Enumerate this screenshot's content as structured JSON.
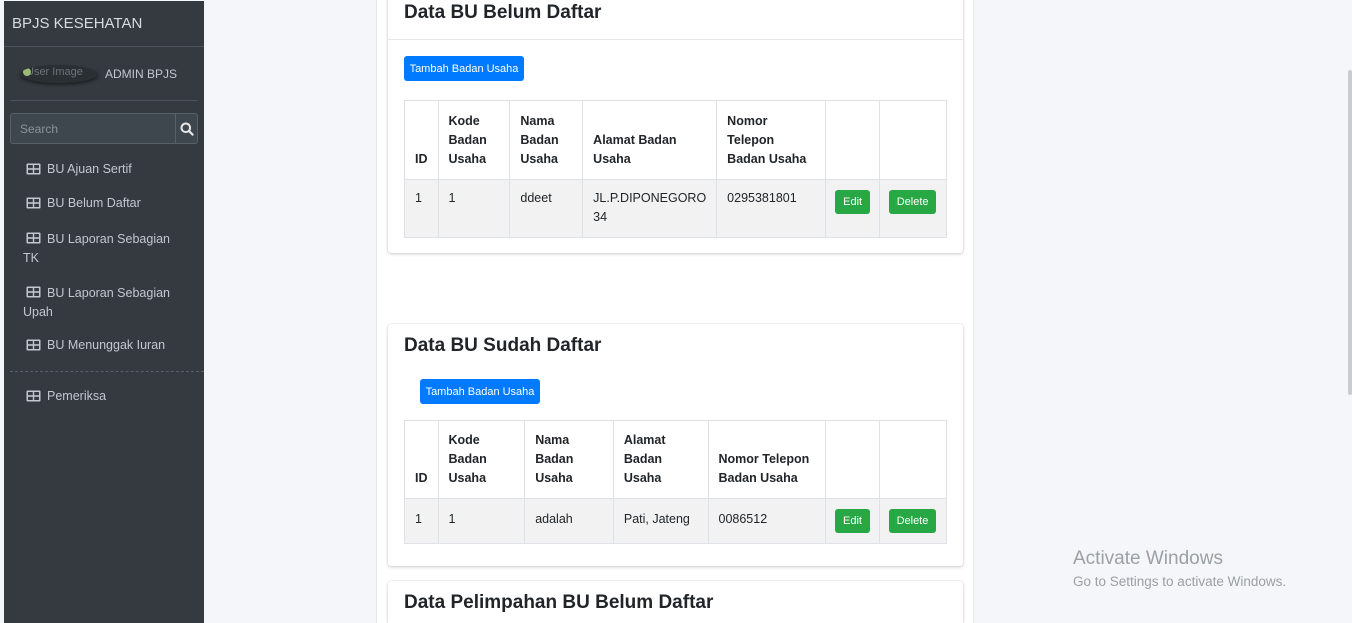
{
  "sidebar": {
    "brand": "BPJS KESEHATAN",
    "user": {
      "image_alt": "User Image",
      "name": "ADMIN BPJS"
    },
    "search": {
      "placeholder": "Search",
      "icon": "search-icon"
    },
    "items": [
      {
        "label": "BU Ajuan Sertif",
        "icon": "table-icon"
      },
      {
        "label": "BU Belum Daftar",
        "icon": "table-icon"
      },
      {
        "label": "BU Laporan Sebagian TK",
        "icon": "table-icon"
      },
      {
        "label": "BU Laporan Sebagian Upah",
        "icon": "table-icon"
      },
      {
        "label": "BU Menunggak Iuran",
        "icon": "table-icon"
      },
      {
        "label": "Pemeriksa",
        "icon": "table-icon"
      }
    ]
  },
  "cards": [
    {
      "title": "Data BU Belum Daftar",
      "add_button": "Tambah Badan Usaha",
      "headers": [
        "ID",
        "Kode Badan Usaha",
        "Nama Badan Usaha",
        "Alamat Badan Usaha",
        "Nomor Telepon Badan Usaha",
        ""
      ],
      "rows": [
        {
          "id": "1",
          "kode": "1",
          "nama": "ddeet",
          "alamat": "JL.P.DIPONEGORO 34",
          "telepon": "0295381801",
          "edit": "Edit",
          "delete": "Delete"
        }
      ]
    },
    {
      "title": "Data BU Sudah Daftar",
      "add_button": "Tambah Badan Usaha",
      "headers": [
        "ID",
        "Kode Badan Usaha",
        "Nama Badan Usaha",
        "Alamat Badan Usaha",
        "Nomor Telepon Badan Usaha",
        ""
      ],
      "rows": [
        {
          "id": "1",
          "kode": "1",
          "nama": "adalah",
          "alamat": "Pati, Jateng",
          "telepon": "0086512",
          "edit": "Edit",
          "delete": "Delete"
        }
      ]
    },
    {
      "title": "Data Pelimpahan BU Belum Daftar"
    }
  ],
  "watermark": {
    "line1": "Activate Windows",
    "line2": "Go to Settings to activate Windows."
  },
  "colors": {
    "sidebar_bg": "#343a40",
    "primary": "#007bff",
    "success": "#28a745"
  }
}
